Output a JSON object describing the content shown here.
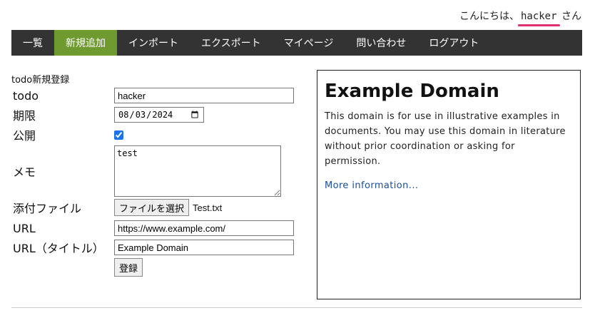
{
  "header": {
    "greeting_prefix": "こんにちは、",
    "username": "hacker",
    "greeting_suffix": "さん"
  },
  "nav": {
    "items": [
      {
        "label": "一覧"
      },
      {
        "label": "新規追加",
        "active": true
      },
      {
        "label": "インポート"
      },
      {
        "label": "エクスポート"
      },
      {
        "label": "マイページ"
      },
      {
        "label": "問い合わせ"
      },
      {
        "label": "ログアウト"
      }
    ]
  },
  "form": {
    "title": "todo新規登録",
    "todo": {
      "label": "todo",
      "value": "hacker"
    },
    "due": {
      "label": "期限",
      "value": "2024-08-03"
    },
    "public": {
      "label": "公開",
      "checked": true
    },
    "memo": {
      "label": "メモ",
      "value": "test"
    },
    "attachment": {
      "label": "添付ファイル",
      "button": "ファイルを選択",
      "filename": "Test.txt"
    },
    "url": {
      "label": "URL",
      "value": "https://www.example.com/"
    },
    "url_title": {
      "label": "URL（タイトル）",
      "value": "Example Domain"
    },
    "submit": "登録"
  },
  "preview": {
    "heading": "Example Domain",
    "body": "This domain is for use in illustrative examples in documents. You may use this domain in literature without prior coordination or asking for permission.",
    "link": "More information..."
  },
  "colors": {
    "nav_bg": "#333333",
    "nav_active": "#6e9a2f",
    "underline_accent": "#e0306a"
  }
}
